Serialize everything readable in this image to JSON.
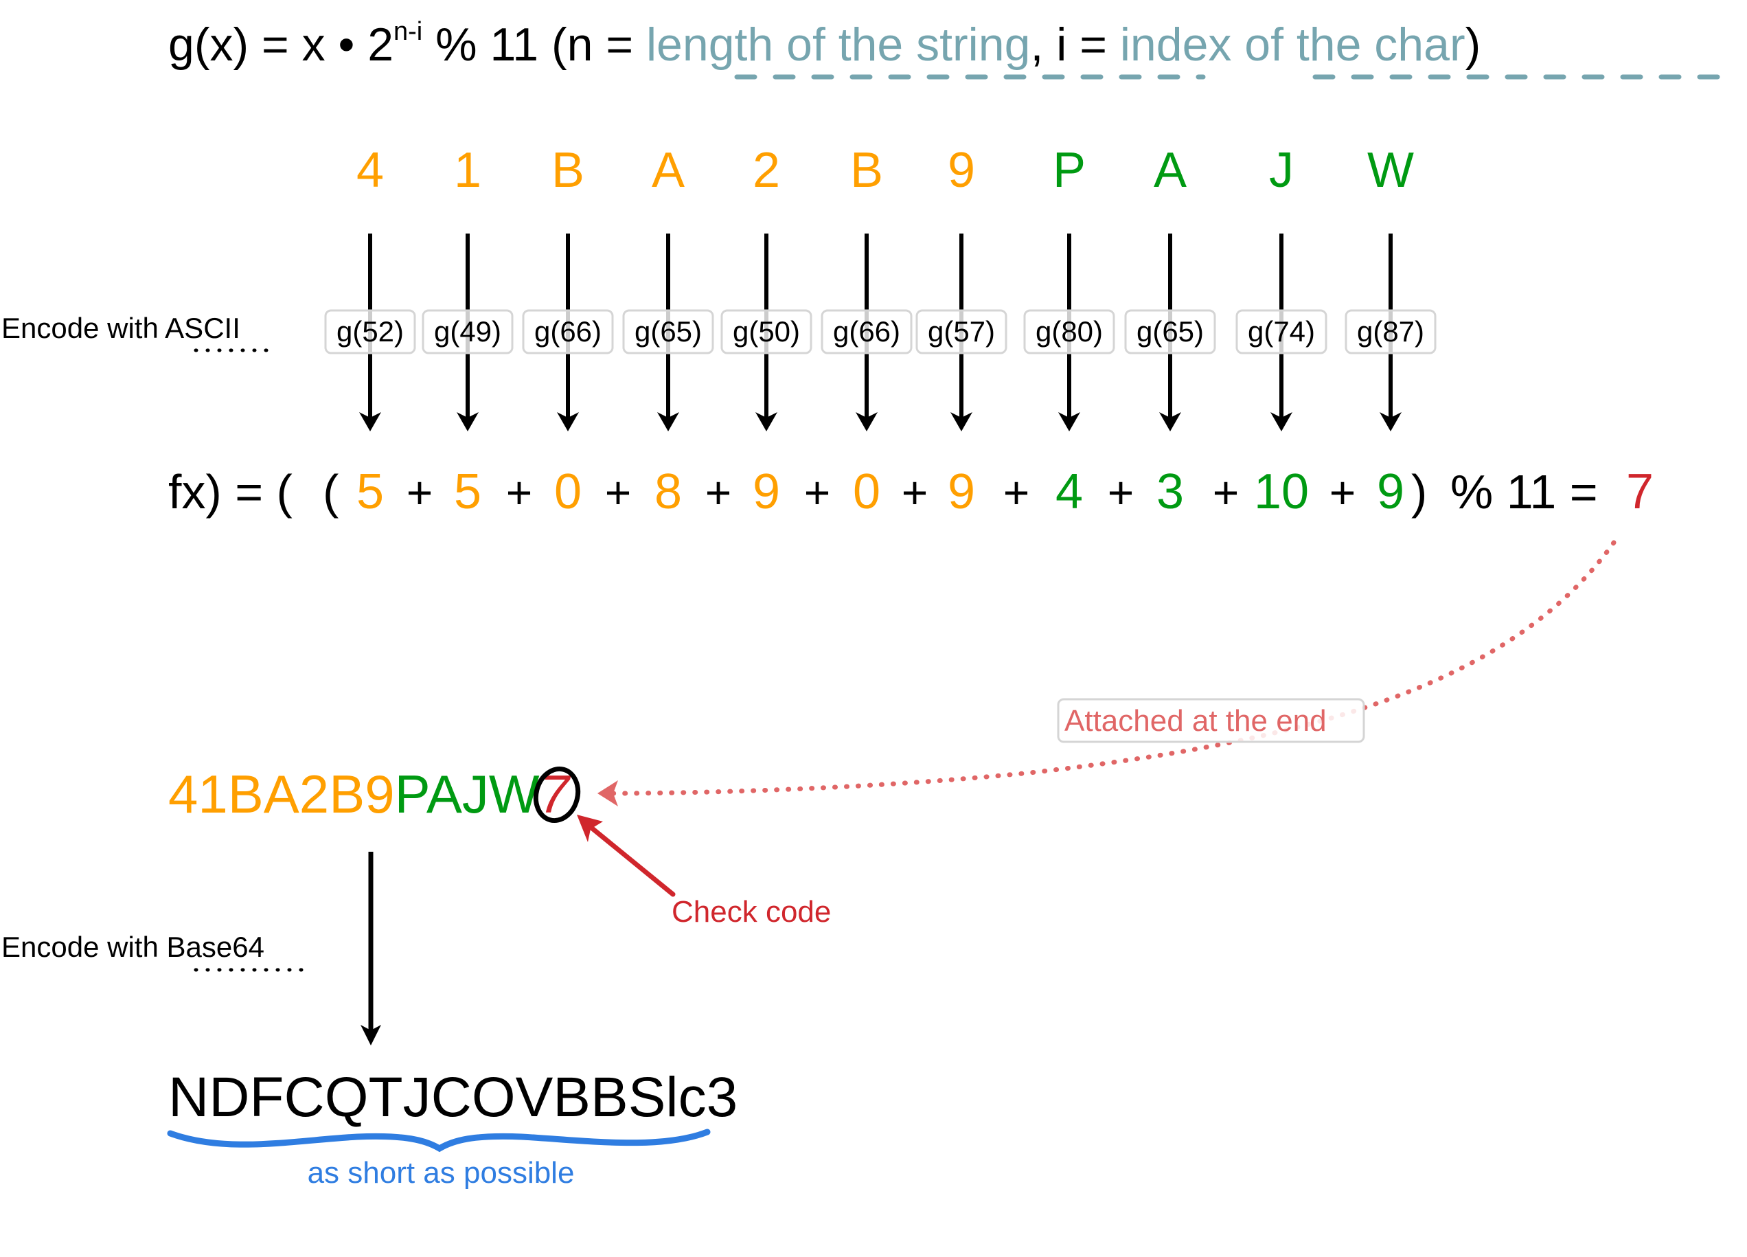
{
  "colors": {
    "black": "#000000",
    "orange": "#ff9f00",
    "green": "#009a12",
    "red": "#d0262c",
    "slate": "#76a5af",
    "salmon": "#e06666",
    "blue": "#2f7de1",
    "box_border": "#d5d5d5"
  },
  "title": {
    "prefix": "g(x) = x • 2",
    "superscript": "n-i",
    "middle": " % 11 (n = ",
    "term_n": "length of the string",
    "comma": ", i = ",
    "term_i": "index of the char",
    "close": ")"
  },
  "characters": [
    {
      "char": "4",
      "group": "orange",
      "g_label": "g(52)",
      "value": "5"
    },
    {
      "char": "1",
      "group": "orange",
      "g_label": "g(49)",
      "value": "5"
    },
    {
      "char": "B",
      "group": "orange",
      "g_label": "g(66)",
      "value": "0"
    },
    {
      "char": "A",
      "group": "orange",
      "g_label": "g(65)",
      "value": "8"
    },
    {
      "char": "2",
      "group": "orange",
      "g_label": "g(50)",
      "value": "9"
    },
    {
      "char": "B",
      "group": "orange",
      "g_label": "g(66)",
      "value": "0"
    },
    {
      "char": "9",
      "group": "orange",
      "g_label": "g(57)",
      "value": "9"
    },
    {
      "char": "P",
      "group": "green",
      "g_label": "g(80)",
      "value": "4"
    },
    {
      "char": "A",
      "group": "green",
      "g_label": "g(65)",
      "value": "3"
    },
    {
      "char": "J",
      "group": "green",
      "g_label": "g(74)",
      "value": "10"
    },
    {
      "char": "W",
      "group": "green",
      "g_label": "g(87)",
      "value": "9"
    }
  ],
  "labels": {
    "encode_ascii_prefix": "Encode with ",
    "encode_ascii_term": "ASCII",
    "encode_base64_prefix": "Encode with ",
    "encode_base64_term": "Base64"
  },
  "sum_formula": {
    "prefix": "f(x) = (",
    "plus": "+",
    "close": ")",
    "mod": "% 11 =",
    "result": "7"
  },
  "encoded": {
    "orange_part": "41BA2B9",
    "green_part": "PAJW",
    "check_digit": "7"
  },
  "annotations": {
    "attached": "Attached at the end",
    "check_code": "Check code",
    "short": "as short as possible"
  },
  "base64_result": "NDFCQTJCOVBBSlc3"
}
